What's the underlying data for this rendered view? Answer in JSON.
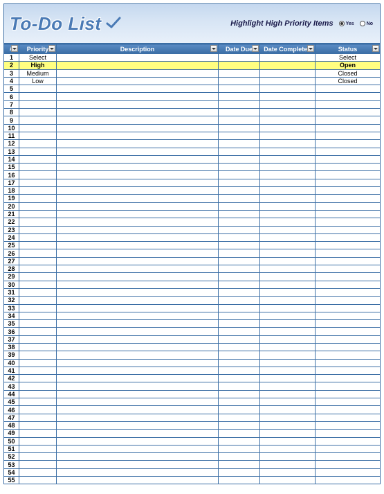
{
  "title": "To-Do List",
  "highlight": {
    "label": "Highlight High Priority Items",
    "yes": "Yes",
    "no": "No",
    "selected": "yes"
  },
  "columns": {
    "num": "#",
    "priority": "Priority",
    "description": "Description",
    "due": "Date Due",
    "complete": "Date Completed",
    "status": "Status"
  },
  "rows": [
    {
      "n": "1",
      "priority": "Select",
      "desc": "",
      "due": "",
      "complete": "",
      "status": "Select",
      "hl": false
    },
    {
      "n": "2",
      "priority": "High",
      "desc": "",
      "due": "",
      "complete": "",
      "status": "Open",
      "hl": true
    },
    {
      "n": "3",
      "priority": "Medium",
      "desc": "",
      "due": "",
      "complete": "",
      "status": "Closed",
      "hl": false
    },
    {
      "n": "4",
      "priority": "Low",
      "desc": "",
      "due": "",
      "complete": "",
      "status": "Closed",
      "hl": false
    },
    {
      "n": "5",
      "priority": "",
      "desc": "",
      "due": "",
      "complete": "",
      "status": "",
      "hl": false
    },
    {
      "n": "6",
      "priority": "",
      "desc": "",
      "due": "",
      "complete": "",
      "status": "",
      "hl": false
    },
    {
      "n": "7",
      "priority": "",
      "desc": "",
      "due": "",
      "complete": "",
      "status": "",
      "hl": false
    },
    {
      "n": "8",
      "priority": "",
      "desc": "",
      "due": "",
      "complete": "",
      "status": "",
      "hl": false
    },
    {
      "n": "9",
      "priority": "",
      "desc": "",
      "due": "",
      "complete": "",
      "status": "",
      "hl": false
    },
    {
      "n": "10",
      "priority": "",
      "desc": "",
      "due": "",
      "complete": "",
      "status": "",
      "hl": false
    },
    {
      "n": "11",
      "priority": "",
      "desc": "",
      "due": "",
      "complete": "",
      "status": "",
      "hl": false
    },
    {
      "n": "12",
      "priority": "",
      "desc": "",
      "due": "",
      "complete": "",
      "status": "",
      "hl": false
    },
    {
      "n": "13",
      "priority": "",
      "desc": "",
      "due": "",
      "complete": "",
      "status": "",
      "hl": false
    },
    {
      "n": "14",
      "priority": "",
      "desc": "",
      "due": "",
      "complete": "",
      "status": "",
      "hl": false
    },
    {
      "n": "15",
      "priority": "",
      "desc": "",
      "due": "",
      "complete": "",
      "status": "",
      "hl": false
    },
    {
      "n": "16",
      "priority": "",
      "desc": "",
      "due": "",
      "complete": "",
      "status": "",
      "hl": false
    },
    {
      "n": "17",
      "priority": "",
      "desc": "",
      "due": "",
      "complete": "",
      "status": "",
      "hl": false
    },
    {
      "n": "18",
      "priority": "",
      "desc": "",
      "due": "",
      "complete": "",
      "status": "",
      "hl": false
    },
    {
      "n": "19",
      "priority": "",
      "desc": "",
      "due": "",
      "complete": "",
      "status": "",
      "hl": false
    },
    {
      "n": "20",
      "priority": "",
      "desc": "",
      "due": "",
      "complete": "",
      "status": "",
      "hl": false
    },
    {
      "n": "21",
      "priority": "",
      "desc": "",
      "due": "",
      "complete": "",
      "status": "",
      "hl": false
    },
    {
      "n": "22",
      "priority": "",
      "desc": "",
      "due": "",
      "complete": "",
      "status": "",
      "hl": false
    },
    {
      "n": "23",
      "priority": "",
      "desc": "",
      "due": "",
      "complete": "",
      "status": "",
      "hl": false
    },
    {
      "n": "24",
      "priority": "",
      "desc": "",
      "due": "",
      "complete": "",
      "status": "",
      "hl": false
    },
    {
      "n": "25",
      "priority": "",
      "desc": "",
      "due": "",
      "complete": "",
      "status": "",
      "hl": false
    },
    {
      "n": "26",
      "priority": "",
      "desc": "",
      "due": "",
      "complete": "",
      "status": "",
      "hl": false
    },
    {
      "n": "27",
      "priority": "",
      "desc": "",
      "due": "",
      "complete": "",
      "status": "",
      "hl": false
    },
    {
      "n": "28",
      "priority": "",
      "desc": "",
      "due": "",
      "complete": "",
      "status": "",
      "hl": false
    },
    {
      "n": "29",
      "priority": "",
      "desc": "",
      "due": "",
      "complete": "",
      "status": "",
      "hl": false
    },
    {
      "n": "30",
      "priority": "",
      "desc": "",
      "due": "",
      "complete": "",
      "status": "",
      "hl": false
    },
    {
      "n": "31",
      "priority": "",
      "desc": "",
      "due": "",
      "complete": "",
      "status": "",
      "hl": false
    },
    {
      "n": "32",
      "priority": "",
      "desc": "",
      "due": "",
      "complete": "",
      "status": "",
      "hl": false
    },
    {
      "n": "33",
      "priority": "",
      "desc": "",
      "due": "",
      "complete": "",
      "status": "",
      "hl": false
    },
    {
      "n": "34",
      "priority": "",
      "desc": "",
      "due": "",
      "complete": "",
      "status": "",
      "hl": false
    },
    {
      "n": "35",
      "priority": "",
      "desc": "",
      "due": "",
      "complete": "",
      "status": "",
      "hl": false
    },
    {
      "n": "36",
      "priority": "",
      "desc": "",
      "due": "",
      "complete": "",
      "status": "",
      "hl": false
    },
    {
      "n": "37",
      "priority": "",
      "desc": "",
      "due": "",
      "complete": "",
      "status": "",
      "hl": false
    },
    {
      "n": "38",
      "priority": "",
      "desc": "",
      "due": "",
      "complete": "",
      "status": "",
      "hl": false
    },
    {
      "n": "39",
      "priority": "",
      "desc": "",
      "due": "",
      "complete": "",
      "status": "",
      "hl": false
    },
    {
      "n": "40",
      "priority": "",
      "desc": "",
      "due": "",
      "complete": "",
      "status": "",
      "hl": false
    },
    {
      "n": "41",
      "priority": "",
      "desc": "",
      "due": "",
      "complete": "",
      "status": "",
      "hl": false
    },
    {
      "n": "42",
      "priority": "",
      "desc": "",
      "due": "",
      "complete": "",
      "status": "",
      "hl": false
    },
    {
      "n": "43",
      "priority": "",
      "desc": "",
      "due": "",
      "complete": "",
      "status": "",
      "hl": false
    },
    {
      "n": "44",
      "priority": "",
      "desc": "",
      "due": "",
      "complete": "",
      "status": "",
      "hl": false
    },
    {
      "n": "45",
      "priority": "",
      "desc": "",
      "due": "",
      "complete": "",
      "status": "",
      "hl": false
    },
    {
      "n": "46",
      "priority": "",
      "desc": "",
      "due": "",
      "complete": "",
      "status": "",
      "hl": false
    },
    {
      "n": "47",
      "priority": "",
      "desc": "",
      "due": "",
      "complete": "",
      "status": "",
      "hl": false
    },
    {
      "n": "48",
      "priority": "",
      "desc": "",
      "due": "",
      "complete": "",
      "status": "",
      "hl": false
    },
    {
      "n": "49",
      "priority": "",
      "desc": "",
      "due": "",
      "complete": "",
      "status": "",
      "hl": false
    },
    {
      "n": "50",
      "priority": "",
      "desc": "",
      "due": "",
      "complete": "",
      "status": "",
      "hl": false
    },
    {
      "n": "51",
      "priority": "",
      "desc": "",
      "due": "",
      "complete": "",
      "status": "",
      "hl": false
    },
    {
      "n": "52",
      "priority": "",
      "desc": "",
      "due": "",
      "complete": "",
      "status": "",
      "hl": false
    },
    {
      "n": "53",
      "priority": "",
      "desc": "",
      "due": "",
      "complete": "",
      "status": "",
      "hl": false
    },
    {
      "n": "54",
      "priority": "",
      "desc": "",
      "due": "",
      "complete": "",
      "status": "",
      "hl": false
    },
    {
      "n": "55",
      "priority": "",
      "desc": "",
      "due": "",
      "complete": "",
      "status": "",
      "hl": false
    }
  ]
}
